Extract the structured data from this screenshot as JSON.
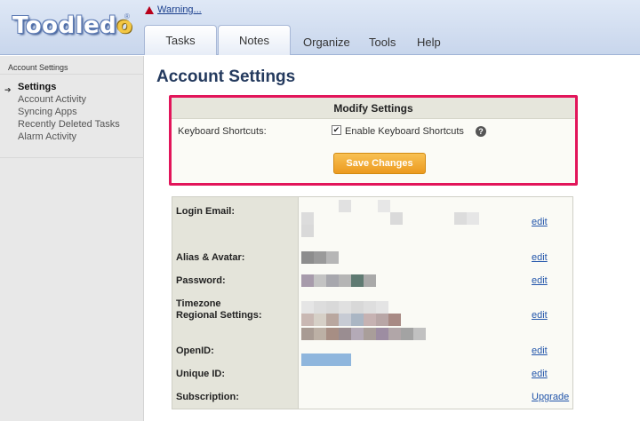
{
  "header": {
    "logo_text": "Toodledo",
    "logo_mark": "®",
    "warning_text": "Warning..."
  },
  "tabs": [
    {
      "label": "Tasks"
    },
    {
      "label": "Notes"
    }
  ],
  "nav_links": [
    {
      "label": "Organize"
    },
    {
      "label": "Tools"
    },
    {
      "label": "Help"
    }
  ],
  "sidebar": {
    "heading": "Account Settings",
    "items": [
      {
        "label": "Settings",
        "active": true
      },
      {
        "label": "Account Activity"
      },
      {
        "label": "Syncing Apps"
      },
      {
        "label": "Recently Deleted Tasks"
      },
      {
        "label": "Alarm Activity"
      }
    ]
  },
  "main": {
    "title": "Account Settings",
    "modify": {
      "header": "Modify Settings",
      "keyboard_label": "Keyboard Shortcuts:",
      "checkbox_checked": true,
      "checkbox_label": "Enable Keyboard Shortcuts",
      "help_symbol": "?",
      "save_label": "Save Changes"
    },
    "rows": [
      {
        "label": "Login Email:",
        "action": "edit"
      },
      {
        "label": "Alias & Avatar:",
        "action": "edit"
      },
      {
        "label": "Password:",
        "action": "edit"
      },
      {
        "label": "Timezone",
        "label2": "Regional Settings:",
        "action": "edit"
      },
      {
        "label": "OpenID:",
        "action": "edit"
      },
      {
        "label": "Unique ID:",
        "action": "edit"
      },
      {
        "label": "Subscription:",
        "action": "Upgrade"
      }
    ]
  },
  "colors": {
    "highlight_border": "#e2155a",
    "save_button": "#ec9a1f",
    "link": "#2255aa",
    "title": "#243a5e"
  }
}
